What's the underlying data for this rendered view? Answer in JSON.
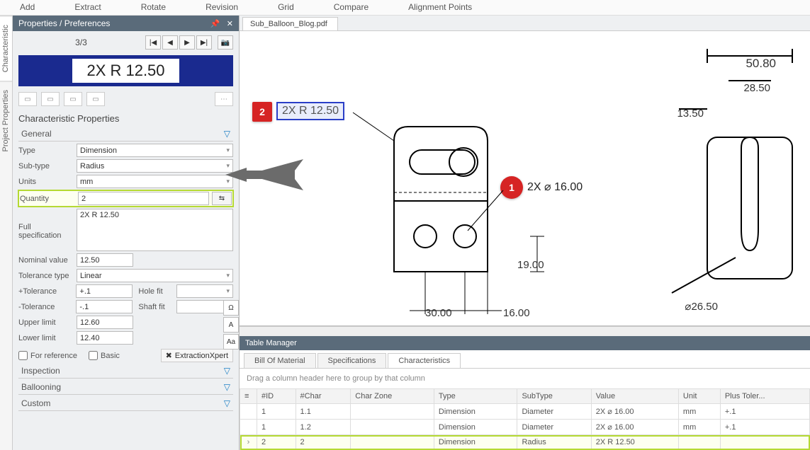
{
  "toolbar": [
    "Add",
    "Extract",
    "Rotate",
    "Revision",
    "Grid",
    "Compare",
    "Alignment Points"
  ],
  "vertTabs": {
    "t1": "Characteristic",
    "t2": "Project Properties"
  },
  "panelTitle": "Properties / Preferences",
  "navCounter": "3/3",
  "featureText": "2X R 12.50",
  "propsTitle": "Characteristic Properties",
  "accordions": {
    "general": "General",
    "inspection": "Inspection",
    "ballooning": "Ballooning",
    "custom": "Custom"
  },
  "labels": {
    "type": "Type",
    "subtype": "Sub-type",
    "units": "Units",
    "quantity": "Quantity",
    "fullspec": "Full specification",
    "nominal": "Nominal value",
    "toltype": "Tolerance type",
    "ptol": "+Tolerance",
    "ntol": "-Tolerance",
    "holefit": "Hole fit",
    "shaftfit": "Shaft fit",
    "upper": "Upper limit",
    "lower": "Lower limit",
    "forref": "For reference",
    "basic": "Basic",
    "extract": "ExtractionXpert"
  },
  "values": {
    "type": "Dimension",
    "subtype": "Radius",
    "units": "mm",
    "quantity": "2",
    "fullspec": "2X R 12.50",
    "nominal": "12.50",
    "toltype": "Linear",
    "ptol": "+.1",
    "ntol": "-.1",
    "holefit": "",
    "shaftfit": "",
    "upper": "12.60",
    "lower": "12.40"
  },
  "docTab": "Sub_Balloon_Blog.pdf",
  "drawing": {
    "b2label": "2X R 12.50",
    "dimDiam": "2X ⌀ 16.00",
    "d19": "19.00",
    "d30": "30.00",
    "d16": "16.00",
    "d50": "50.80",
    "d28": "28.50",
    "d13": "13.50",
    "d26": "⌀26.50"
  },
  "tableMgr": "Table Manager",
  "tmTabs": {
    "bom": "Bill Of Material",
    "spec": "Specifications",
    "char": "Characteristics"
  },
  "tmHint": "Drag a column header here to group by that column",
  "cols": {
    "id": "#ID",
    "char": "#Char",
    "zone": "Char Zone",
    "type": "Type",
    "sub": "SubType",
    "val": "Value",
    "unit": "Unit",
    "plus": "Plus Toler..."
  },
  "rows": [
    {
      "id": "1",
      "char": "1.1",
      "zone": "",
      "type": "Dimension",
      "sub": "Diameter",
      "val": "2X ⌀ 16.00",
      "unit": "mm",
      "plus": "+.1"
    },
    {
      "id": "1",
      "char": "1.2",
      "zone": "",
      "type": "Dimension",
      "sub": "Diameter",
      "val": "2X ⌀ 16.00",
      "unit": "mm",
      "plus": "+.1"
    },
    {
      "id": "2",
      "char": "2",
      "zone": "",
      "type": "Dimension",
      "sub": "Radius",
      "val": "2X R 12.50",
      "unit": "",
      "plus": ""
    }
  ]
}
